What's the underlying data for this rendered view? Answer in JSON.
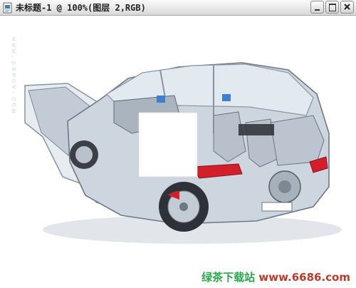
{
  "window": {
    "title": "未标题-1 @ 100%(图层 2,RGB)",
    "controls": {
      "minimize": "minimize-icon",
      "maximize": "maximize-icon",
      "close": "close-icon"
    }
  },
  "canvas": {
    "watermark": "www.pamov.com",
    "footer": {
      "site_cn": "绿茶下载站",
      "site_url": "www.6686.com"
    }
  },
  "colors": {
    "titlebar_top": "#fbfbfb",
    "titlebar_bottom": "#d9d9d9",
    "brand_green": "#2aa84a",
    "brand_red": "#c0392b",
    "car_body": "#c9d2dc",
    "car_frame": "#8a94a1",
    "tail_light": "#d21f2b",
    "glass": "#dfe7ee"
  }
}
